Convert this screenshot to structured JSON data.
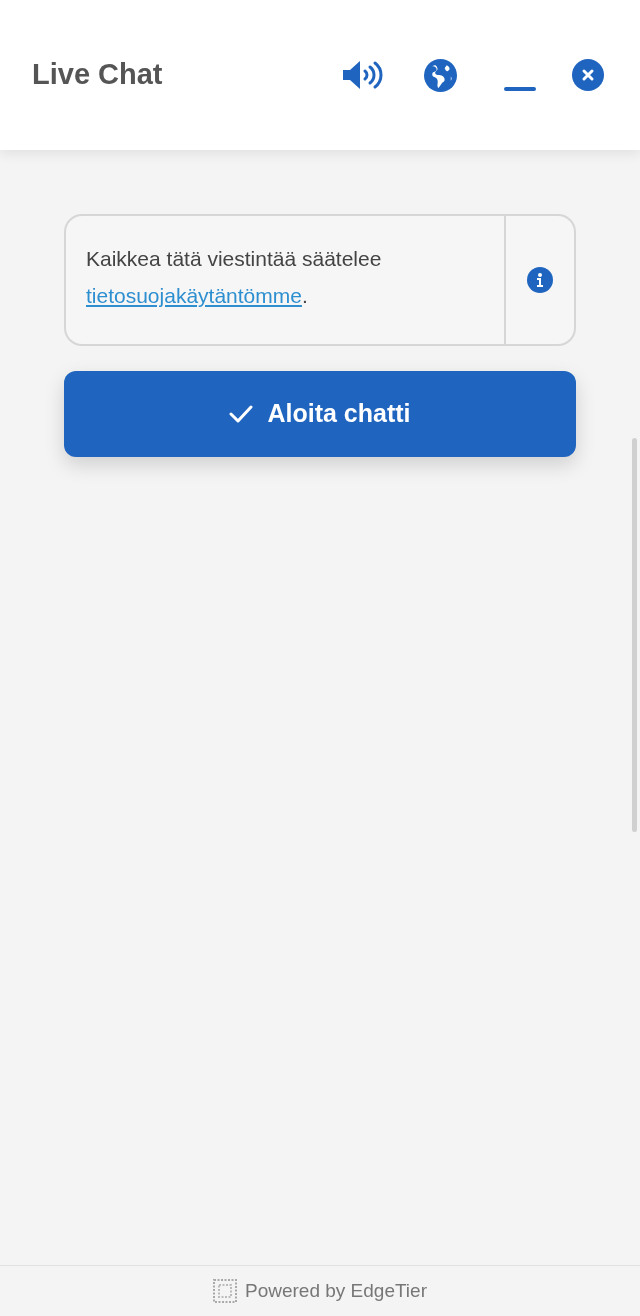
{
  "header": {
    "title": "Live Chat"
  },
  "notice": {
    "text": "Kaikkea tätä viestintää säätelee",
    "link": "tietosuojakäytäntömme",
    "after": "."
  },
  "start_button": {
    "label": "Aloita chatti"
  },
  "footer": {
    "text": "Powered by EdgeTier"
  }
}
